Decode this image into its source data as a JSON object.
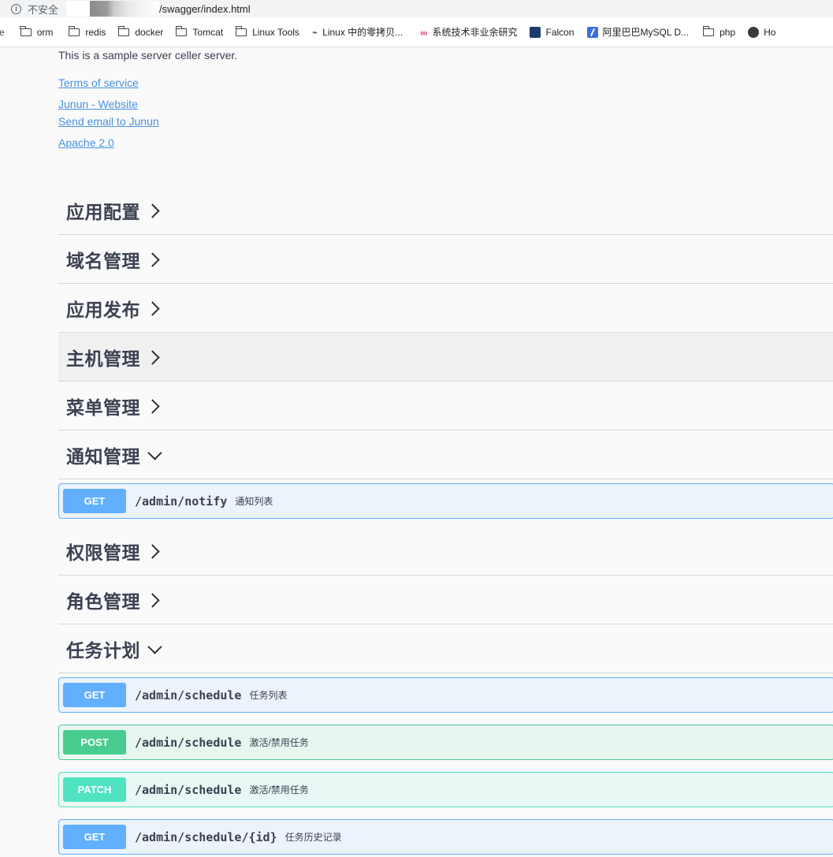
{
  "browser": {
    "security_label": "不安全",
    "url": "/swagger/index.html",
    "bookmarks": [
      {
        "label": "orm",
        "icon": "folder-icon"
      },
      {
        "label": "redis",
        "icon": "folder-icon"
      },
      {
        "label": "docker",
        "icon": "folder-icon"
      },
      {
        "label": "Tomcat",
        "icon": "folder-icon"
      },
      {
        "label": "Linux Tools",
        "icon": "folder-icon"
      },
      {
        "label": "Linux 中的零拷贝...",
        "icon": "usb-icon"
      },
      {
        "label": "系统技术非业余研究",
        "icon": "infinity-icon"
      },
      {
        "label": "Falcon",
        "icon": "falcon-icon"
      },
      {
        "label": "阿里巴巴MySQL D...",
        "icon": "feather-icon"
      },
      {
        "label": "php",
        "icon": "folder-icon"
      },
      {
        "label": "Ho",
        "icon": "globe-icon"
      }
    ],
    "bookmark_cut_prefix": "e"
  },
  "info": {
    "description": "This is a sample server celler server.",
    "terms": "Terms of service",
    "website": "Junun - Website",
    "email": "Send email to Junun",
    "license": "Apache 2.0"
  },
  "tags": [
    {
      "name": "应用配置",
      "expanded": false
    },
    {
      "name": "域名管理",
      "expanded": false
    },
    {
      "name": "应用发布",
      "expanded": false
    },
    {
      "name": "主机管理",
      "expanded": false
    },
    {
      "name": "菜单管理",
      "expanded": false
    },
    {
      "name": "通知管理",
      "expanded": true
    },
    {
      "name": "权限管理",
      "expanded": false
    },
    {
      "name": "角色管理",
      "expanded": false
    },
    {
      "name": "任务计划",
      "expanded": true
    }
  ],
  "operations": {
    "notify_get": {
      "method": "GET",
      "path": "/admin/notify",
      "summary": "通知列表"
    },
    "schedule_get": {
      "method": "GET",
      "path": "/admin/schedule",
      "summary": "任务列表"
    },
    "schedule_post": {
      "method": "POST",
      "path": "/admin/schedule",
      "summary": "激活/禁用任务"
    },
    "schedule_patch": {
      "method": "PATCH",
      "path": "/admin/schedule",
      "summary": "激活/禁用任务"
    },
    "schedule_history": {
      "method": "GET",
      "path": "/admin/schedule/{id}",
      "summary": "任务历史记录"
    }
  },
  "colors": {
    "get": "#61affe",
    "post": "#49cc90",
    "patch": "#50e3c2",
    "link": "#4990e2"
  }
}
